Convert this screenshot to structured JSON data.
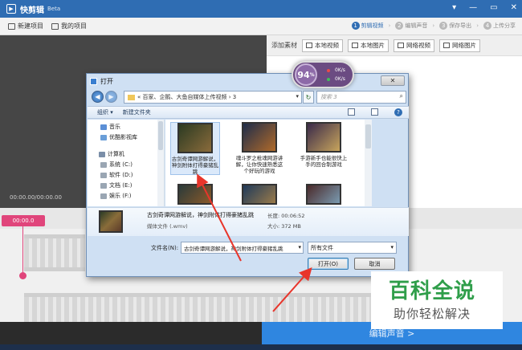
{
  "app": {
    "title": "快剪辑",
    "beta": "Beta",
    "window_controls": [
      "▾",
      "—",
      "▭",
      "✕"
    ]
  },
  "project_bar": {
    "new_project": "新建项目",
    "my_projects": "我的项目"
  },
  "steps": [
    {
      "num": "1",
      "label": "剪辑视频",
      "active": true
    },
    {
      "num": "2",
      "label": "编辑声音",
      "active": false
    },
    {
      "num": "3",
      "label": "保存导出",
      "active": false
    },
    {
      "num": "4",
      "label": "上传分享",
      "active": false
    }
  ],
  "material_bar": {
    "label": "添加素材",
    "buttons": [
      "本地视频",
      "本地图片",
      "网络视频",
      "网络图片"
    ]
  },
  "preview": {
    "timecode": "00:00.00/00:00.00"
  },
  "timeline": {
    "playhead": "00:00.0"
  },
  "next_step": "编辑声音 >",
  "dialog": {
    "title": "打开",
    "close": "✕",
    "address": "« 百家、企鹅、大鱼自媒体上传视频 › 3",
    "search_placeholder": "搜索 3",
    "toolbar": {
      "organize": "组织 ▾",
      "new_folder": "新建文件夹"
    },
    "nav": [
      {
        "label": "音乐",
        "icon": "music-icon"
      },
      {
        "label": "优酷影视库",
        "icon": "library-icon"
      },
      {
        "label": "计算机",
        "icon": "computer-icon"
      },
      {
        "label": "系统 (C:)",
        "icon": "drive-icon"
      },
      {
        "label": "软件 (D:)",
        "icon": "drive-icon"
      },
      {
        "label": "文档 (E:)",
        "icon": "drive-icon"
      },
      {
        "label": "娱乐 (F:)",
        "icon": "drive-icon"
      }
    ],
    "files": [
      {
        "name": "古剑奇谭网游解说，神剑附体打得豪猪乱跳",
        "selected": true,
        "colors": [
          "#2b3a22",
          "#8a6b3b"
        ]
      },
      {
        "name": "魂斗罗之枪魂网游讲解，让你快速熟悉这个好玩的游戏",
        "selected": false,
        "colors": [
          "#1f2d4a",
          "#b06a2a"
        ]
      },
      {
        "name": "手游新手也能很快上手的回合制游戏",
        "selected": false,
        "colors": [
          "#3a2a4a",
          "#c7a45c"
        ]
      },
      {
        "name": "",
        "selected": false,
        "colors": [
          "#2a3a3a",
          "#8a5a2a"
        ]
      },
      {
        "name": "",
        "selected": false,
        "colors": [
          "#1f3a5a",
          "#9a7a4a"
        ]
      },
      {
        "name": "",
        "selected": false,
        "colors": [
          "#4a2a2a",
          "#7a9ab0"
        ]
      }
    ],
    "speed": {
      "percent": "94",
      "unit": "%",
      "up": "0K/s",
      "down": "0K/s"
    },
    "details": {
      "name": "古剑奇谭网游解说，神剑附体打得豪猪乱跳",
      "type": "媒体文件 (.wmv)",
      "duration": "长度: 00:06:52",
      "size": "大小: 372 MB"
    },
    "filename_label": "文件名(N):",
    "filename_value": "古剑奇谭网游解说，神剑附体打得豪猪乱跳",
    "filter": "所有文件",
    "open_button": "打开(O)",
    "cancel_button": "取消"
  },
  "watermark": {
    "big": "百科全说",
    "small": "助你轻松解决"
  },
  "colors": {
    "accent": "#2f6db3",
    "playhead": "#e0457b",
    "annotation": "#e8352b",
    "watermark_green": "#2f9e4a"
  }
}
